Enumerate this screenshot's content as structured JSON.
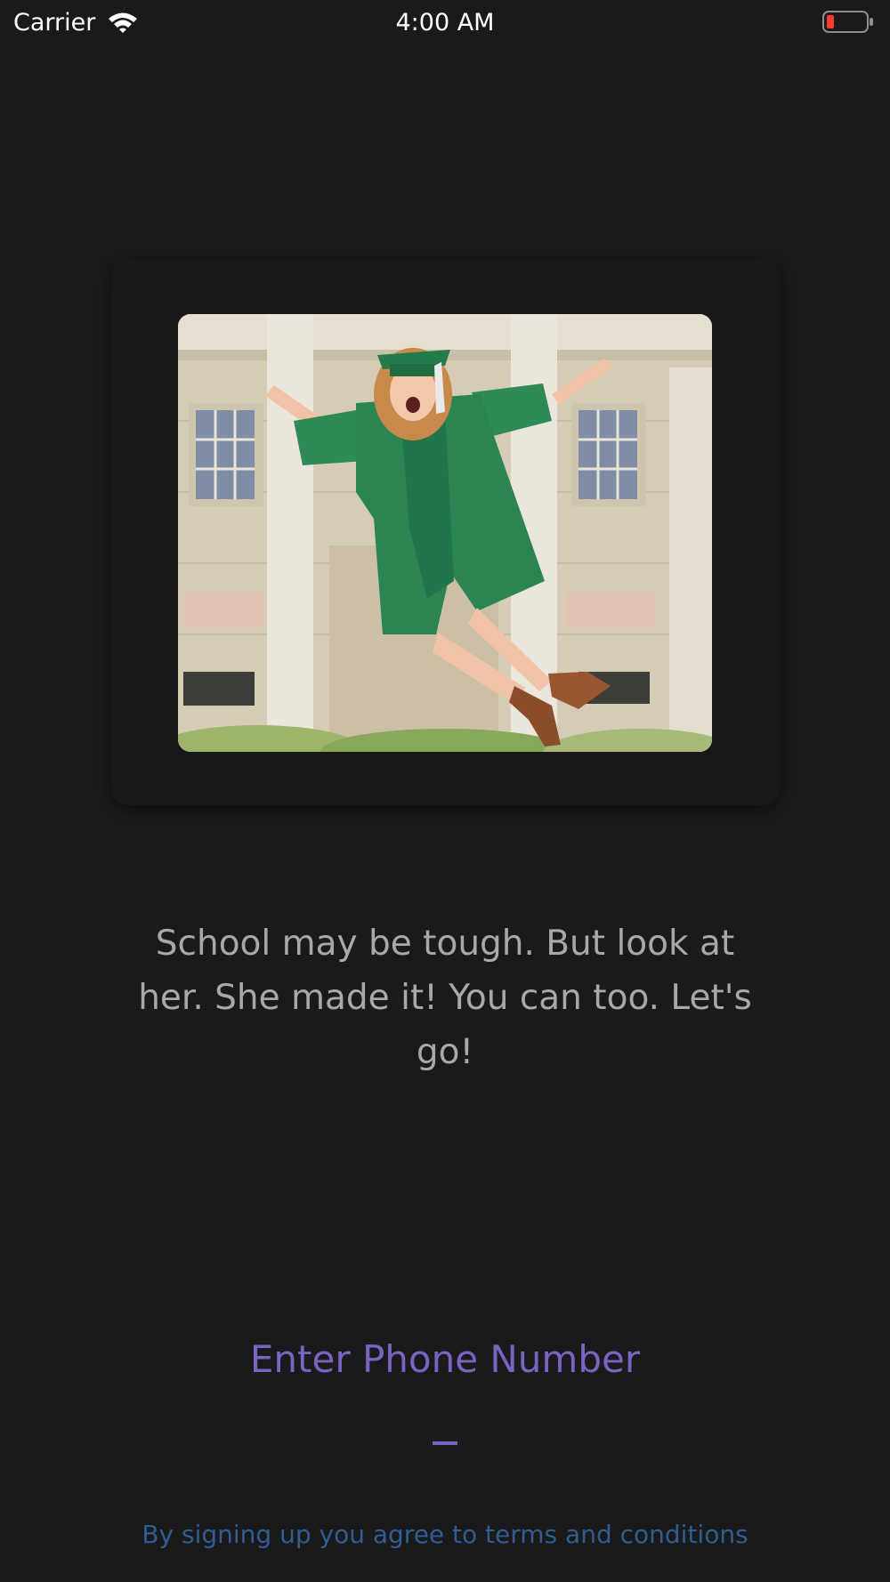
{
  "status_bar": {
    "carrier": "Carrier",
    "time": "4:00 AM",
    "wifi_icon": "wifi-icon",
    "battery_icon": "battery-low-icon",
    "battery_color": "#ff3b30"
  },
  "card": {
    "image_description_icon": "graduate-photo"
  },
  "message": "School may be tough. But look at her. She made it! You can too. Let's go!",
  "phone": {
    "label": "Enter Phone Number",
    "value": "",
    "placeholder": ""
  },
  "terms": "By signing up you agree to terms and conditions",
  "colors": {
    "background": "#1a1a1a",
    "accent": "#7a63c2",
    "terms_link": "#2f5d94",
    "message_text": "#a8a8a8"
  }
}
